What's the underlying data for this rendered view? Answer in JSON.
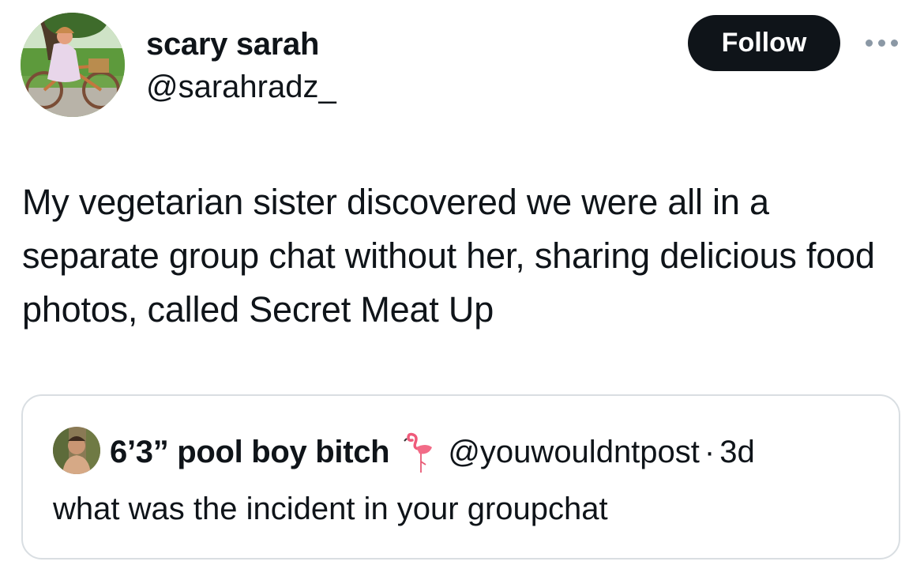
{
  "author": {
    "display_name": "scary sarah",
    "handle": "@sarahradz_",
    "avatar_icon": "profile-photo"
  },
  "actions": {
    "follow_label": "Follow",
    "more_icon": "more-horizontal-icon"
  },
  "tweet": {
    "text": "My vegetarian sister discovered we were all in a separate group chat without her, sharing delicious food photos, called Secret Meat Up"
  },
  "quoted_tweet": {
    "display_name": "6’3” pool boy bitch",
    "name_emoji": "flamingo-icon",
    "handle": "@youwouldntpost",
    "separator": "·",
    "time": "3d",
    "text": "what was the incident in your groupchat"
  },
  "colors": {
    "text": "#0f1419",
    "follow_bg": "#0f1419",
    "border": "#d9dee2",
    "more_dots": "#8b98a5"
  }
}
